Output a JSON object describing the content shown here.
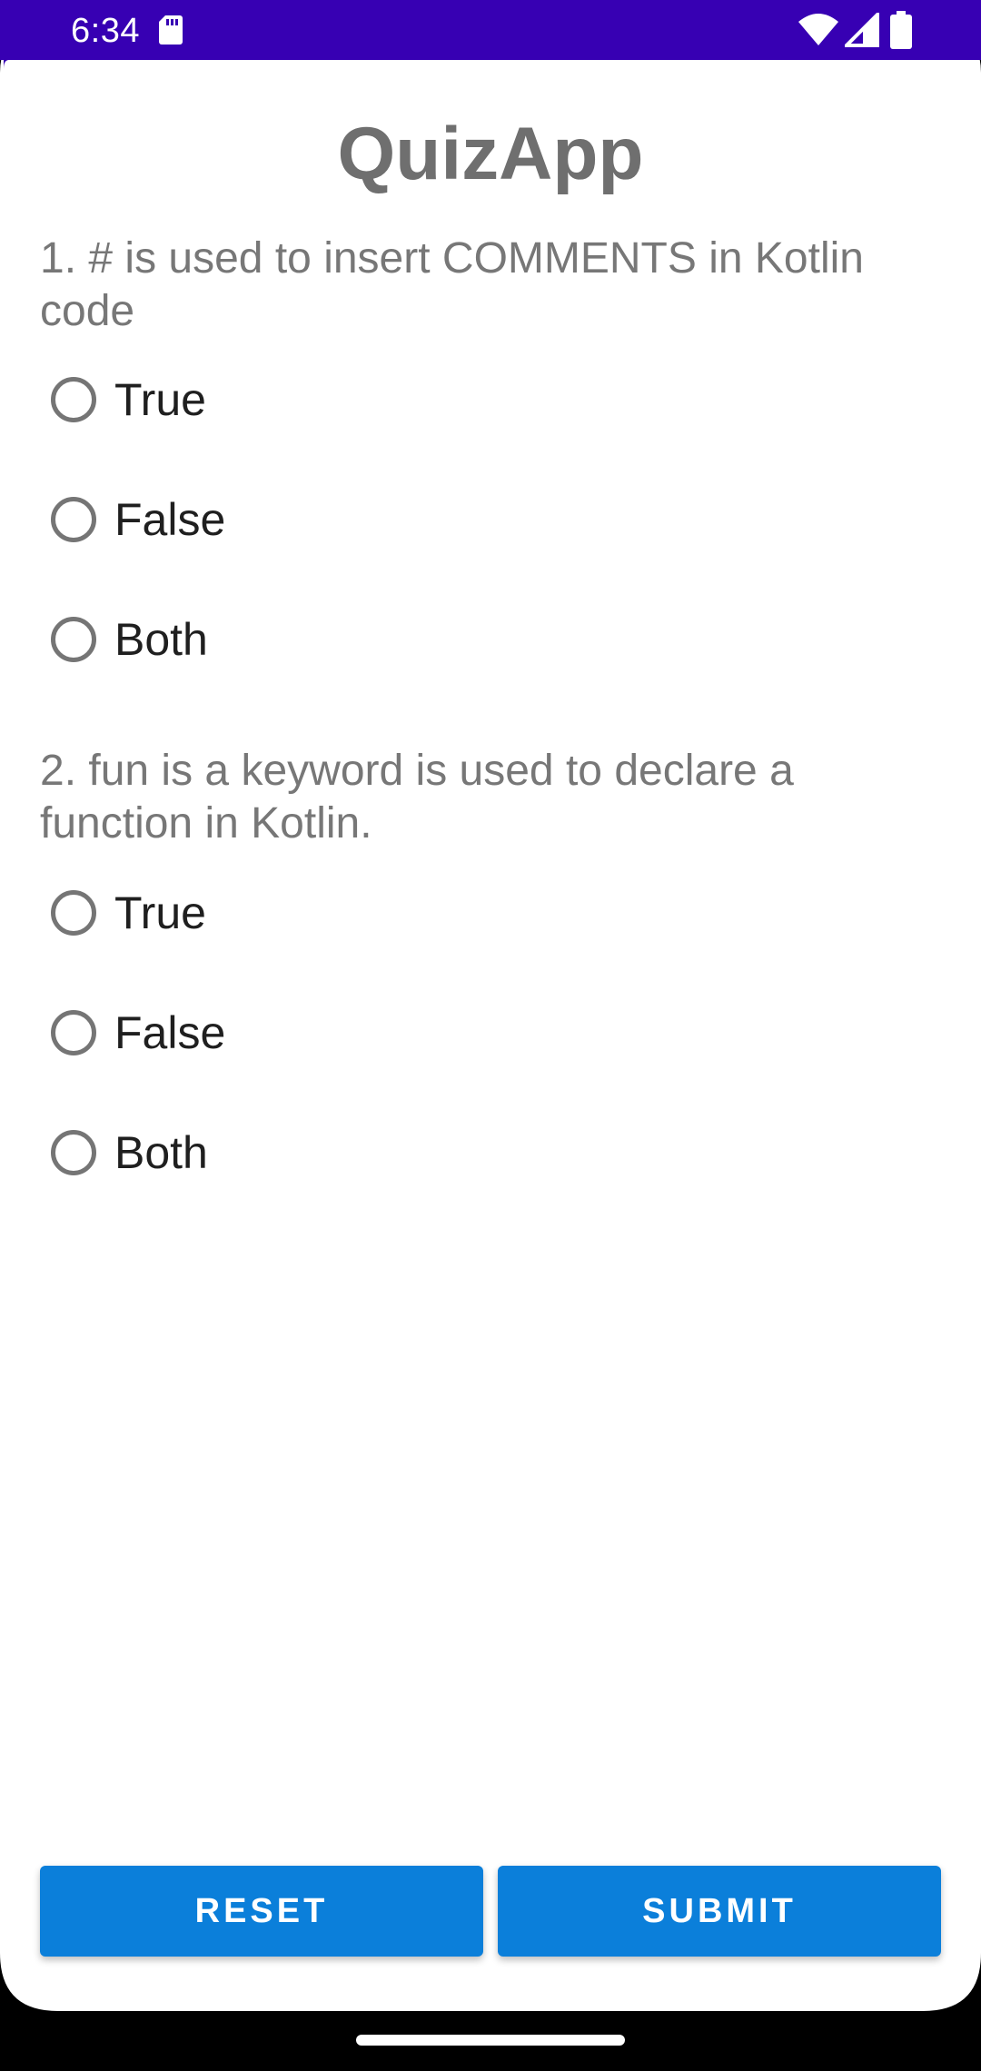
{
  "status_bar": {
    "time": "6:34",
    "icons": [
      "sd-card-icon",
      "wifi-icon",
      "signal-icon",
      "battery-icon"
    ],
    "background": "#3700B3"
  },
  "app": {
    "title": "QuizApp"
  },
  "questions": [
    {
      "text": "1. # is used to insert COMMENTS in Kotlin code",
      "options": [
        "True",
        "False",
        "Both"
      ]
    },
    {
      "text": "2. fun is a keyword is used to declare a function in Kotlin.",
      "options": [
        "True",
        "False",
        "Both"
      ]
    }
  ],
  "actions": {
    "reset_label": "RESET",
    "submit_label": "SUBMIT",
    "button_color": "#0b7fda"
  }
}
